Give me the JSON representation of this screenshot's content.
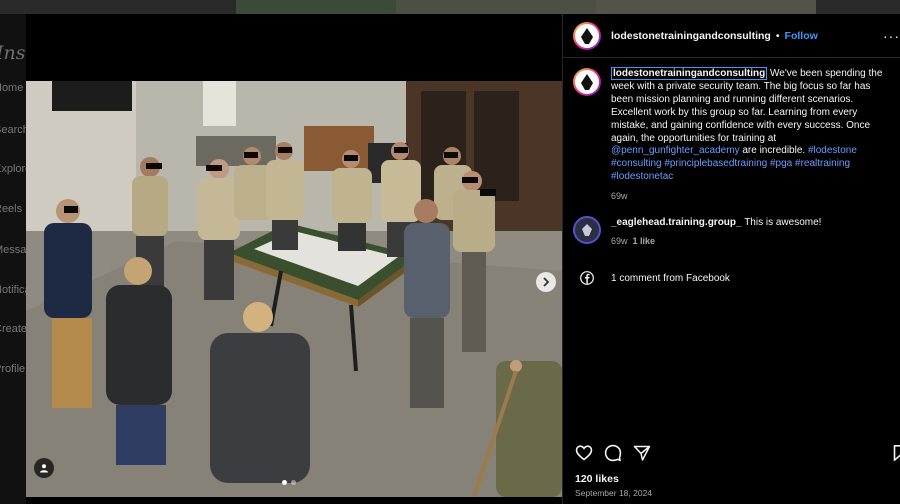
{
  "background_nav": {
    "logo": "Instagram",
    "items": [
      "Home",
      "Search",
      "Explore",
      "Reels",
      "Messages",
      "Notifications",
      "Create",
      "Profile"
    ]
  },
  "post": {
    "author": "lodestonetrainingandconsulting",
    "separator": "•",
    "follow_label": "Follow",
    "more_label": "···",
    "caption": {
      "username": "lodestonetrainingandconsulting",
      "text_1": " We've been spending the week with a private security team. The big focus so far has been mission planning and running different scenarios. Excellent work by this group so far. Learning from every mistake, and gaining confidence with every success. Once again, the opportunities for training at ",
      "mention": "@penn_gunfighter_academy",
      "text_2": " are incredible. ",
      "hashtags": "#lodestone #consulting #principlebasedtraining #pga #realtraining #lodestonetac",
      "age": "69w"
    },
    "comments": [
      {
        "username": "_eaglehead.training.group_",
        "text": " This is awesome!",
        "age": "69w",
        "likes": "1 like"
      }
    ],
    "facebook_comments": "1 comment from Facebook",
    "likes": "120 likes",
    "date": "September 18, 2024",
    "icons": [
      "heart-icon",
      "comment-icon",
      "share-icon",
      "bookmark-icon"
    ],
    "accent_color": "#4493f8"
  }
}
